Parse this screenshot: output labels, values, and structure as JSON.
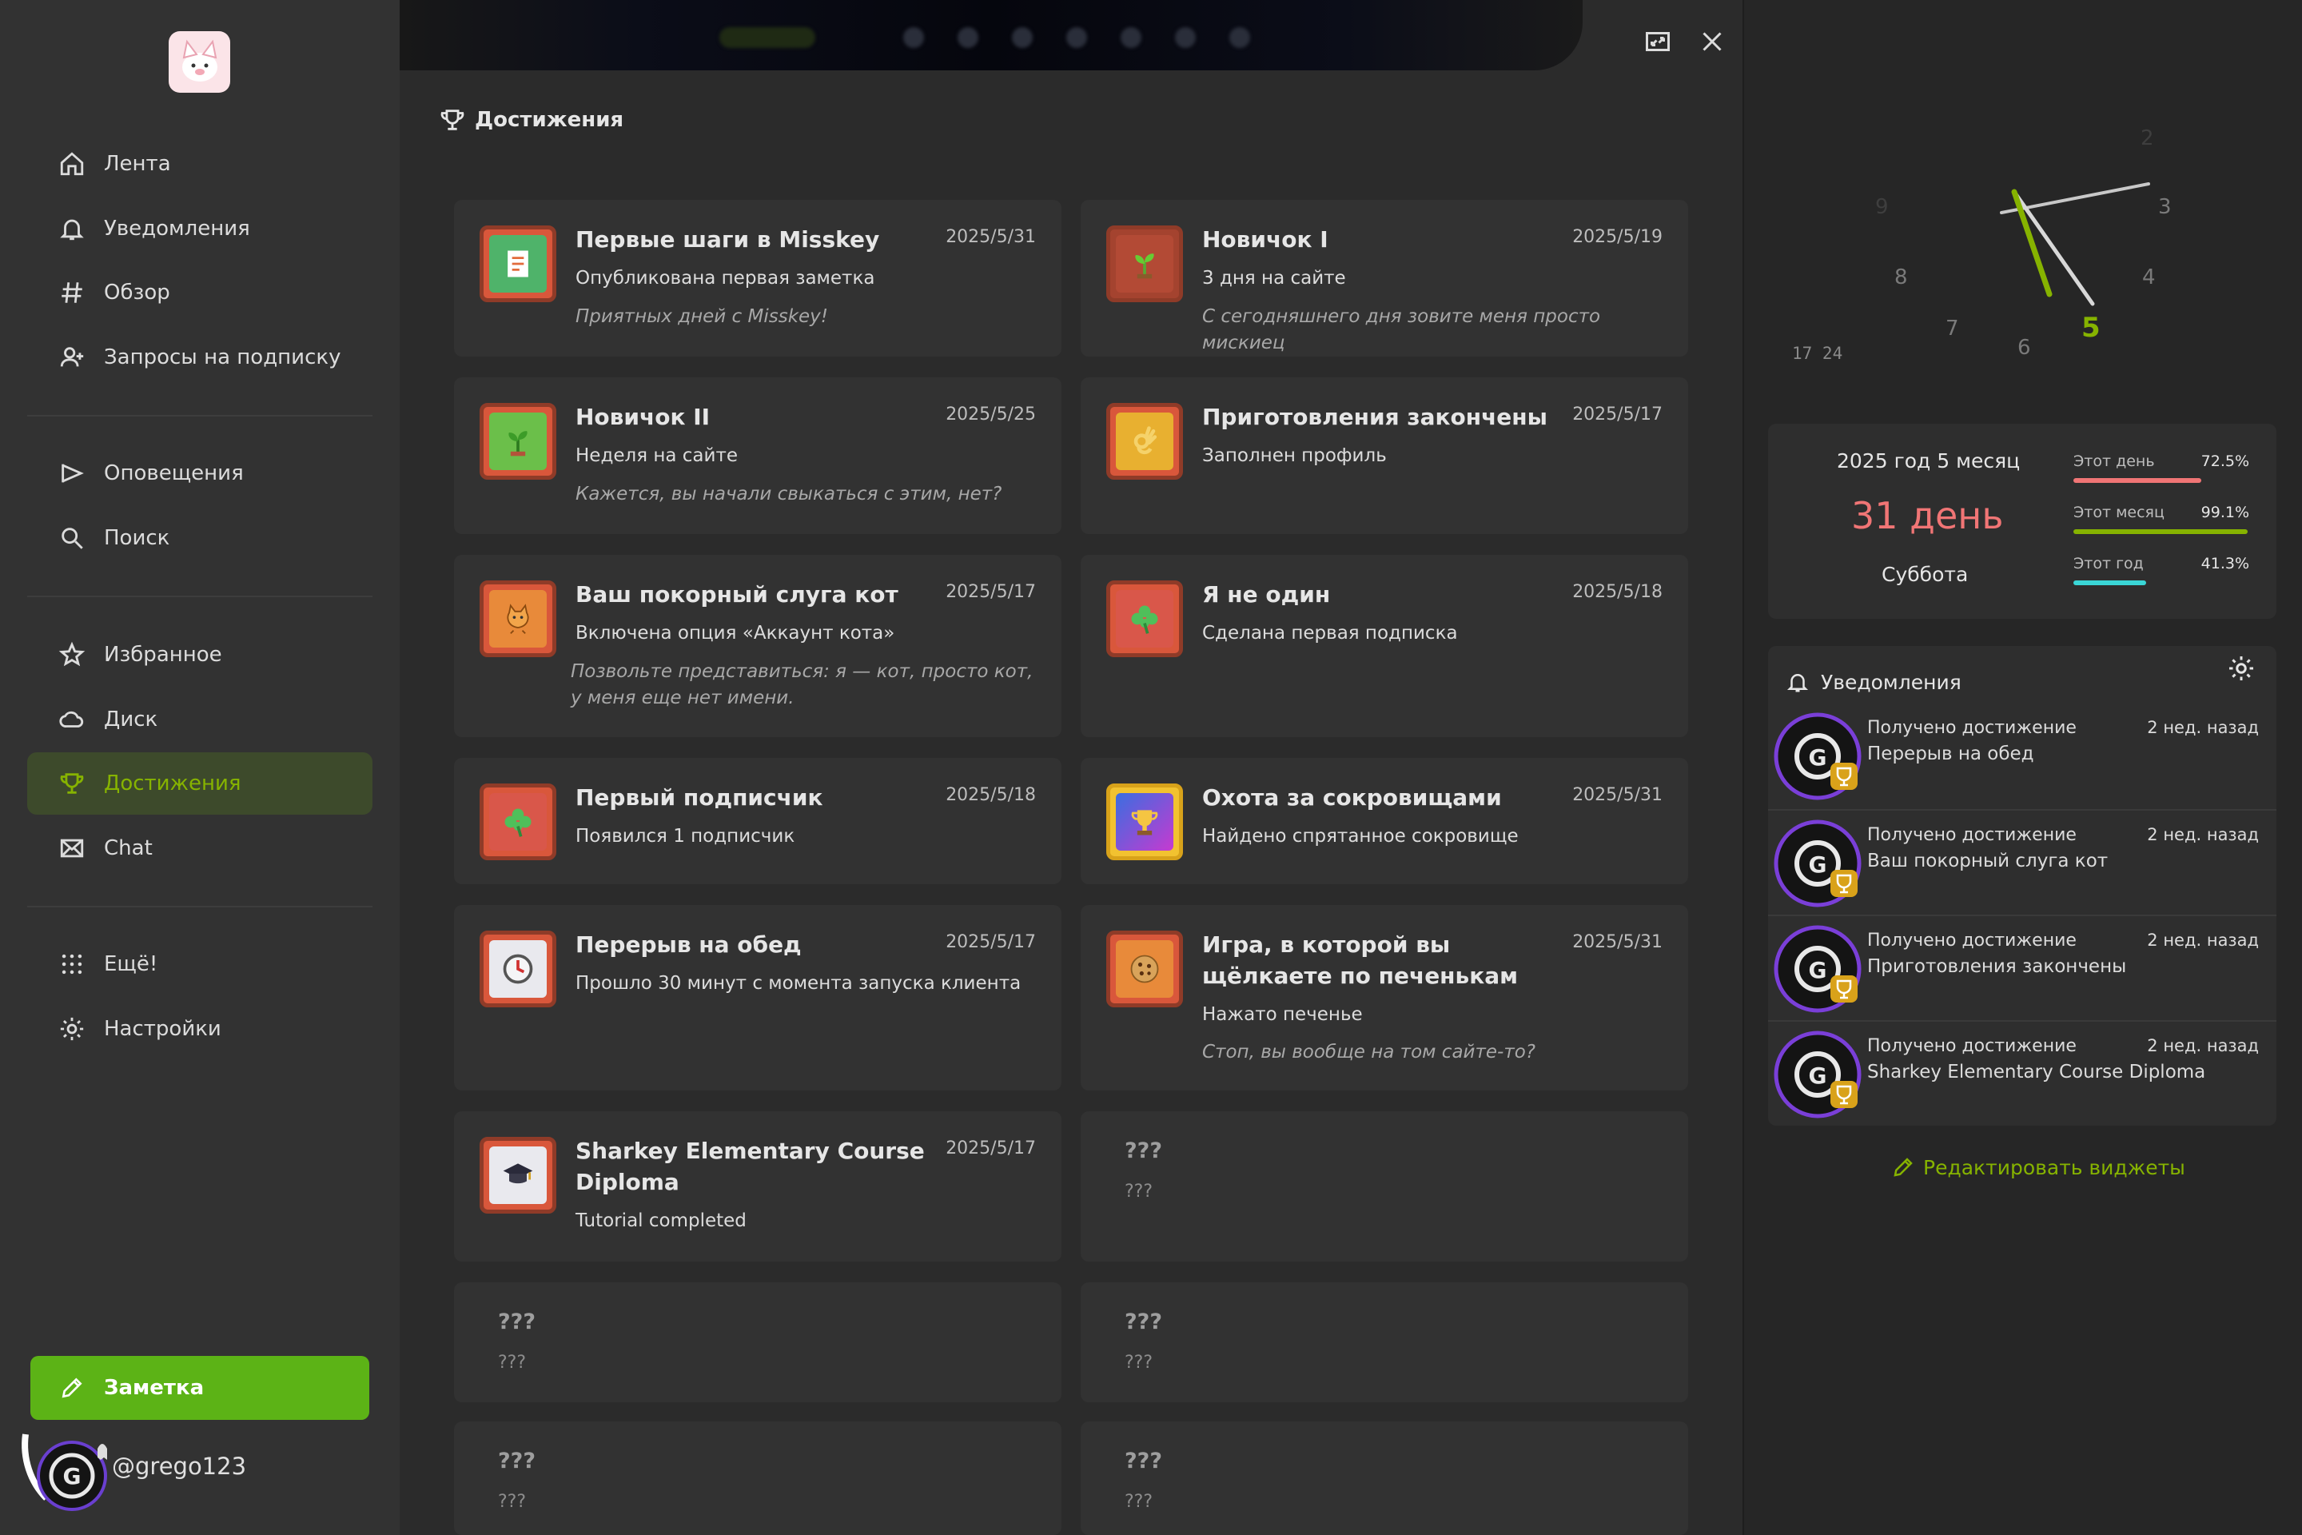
{
  "sidebar": {
    "items": [
      {
        "label": "Лента",
        "icon": "home-icon"
      },
      {
        "label": "Уведомления",
        "icon": "bell-icon"
      },
      {
        "label": "Обзор",
        "icon": "hash-icon"
      },
      {
        "label": "Запросы на подписку",
        "icon": "user-plus-icon"
      },
      {
        "label": "Оповещения",
        "icon": "announcement-icon"
      },
      {
        "label": "Поиск",
        "icon": "search-icon"
      },
      {
        "label": "Избранное",
        "icon": "star-icon"
      },
      {
        "label": "Диск",
        "icon": "cloud-icon"
      },
      {
        "label": "Достижения",
        "icon": "trophy-icon",
        "active": true
      },
      {
        "label": "Chat",
        "icon": "mail-icon"
      },
      {
        "label": "Ещё!",
        "icon": "dots-grid-icon"
      },
      {
        "label": "Настройки",
        "icon": "gear-icon"
      }
    ],
    "note_button": "Заметка",
    "account": "@grego123"
  },
  "page": {
    "title": "Достижения"
  },
  "achievements": [
    {
      "title": "Первые шаги в Misskey",
      "date": "2025/5/31",
      "desc": "Опубликована первая заметка",
      "flavor": "Приятных дней с Misskey!",
      "icon": "note-icon"
    },
    {
      "title": "Новичок I",
      "date": "2025/5/19",
      "desc": "3 дня на сайте",
      "flavor": "С сегодняшнего дня зовите меня просто мискиец",
      "icon": "sprout-icon"
    },
    {
      "title": "Новичок II",
      "date": "2025/5/25",
      "desc": "Неделя на сайте",
      "flavor": "Кажется, вы начали свыкаться с этим, нет?",
      "icon": "sprout-icon"
    },
    {
      "title": "Приготовления закончены",
      "date": "2025/5/17",
      "desc": "Заполнен профиль",
      "flavor": "",
      "icon": "ok-hand-icon"
    },
    {
      "title": "Ваш покорный слуга кот",
      "date": "2025/5/17",
      "desc": "Включена опция «Аккаунт кота»",
      "flavor": "Позвольте представиться: я — кот, просто кот, у меня еще нет имени.",
      "icon": "cat-icon"
    },
    {
      "title": "Я не один",
      "date": "2025/5/18",
      "desc": "Сделана первая подписка",
      "flavor": "",
      "icon": "clover-icon"
    },
    {
      "title": "Первый подписчик",
      "date": "2025/5/18",
      "desc": "Появился 1 подписчик",
      "flavor": "",
      "icon": "clover-icon"
    },
    {
      "title": "Охота за сокровищами",
      "date": "2025/5/31",
      "desc": "Найдено спрятанное сокровище",
      "flavor": "",
      "icon": "trophy-icon"
    },
    {
      "title": "Перерыв на обед",
      "date": "2025/5/17",
      "desc": "Прошло 30 минут с момента запуска клиента",
      "flavor": "",
      "icon": "clock-icon"
    },
    {
      "title": "Игра, в которой вы щёлкаете по печенькам",
      "date": "2025/5/31",
      "desc": "Нажато печенье",
      "flavor": "Стоп, вы вообще на том сайте-то?",
      "icon": "cookie-icon"
    },
    {
      "title": "Sharkey Elementary Course Diploma",
      "date": "2025/5/17",
      "desc": "Tutorial completed",
      "flavor": "",
      "icon": "graduation-cap-icon"
    },
    {
      "title": "???",
      "desc": "???"
    },
    {
      "title": "???",
      "desc": "???"
    },
    {
      "title": "???",
      "desc": "???"
    },
    {
      "title": "???",
      "desc": "???"
    },
    {
      "title": "???",
      "desc": "???"
    }
  ],
  "clock": {
    "numbers": [
      "2",
      "3",
      "4",
      "5",
      "6",
      "7",
      "8",
      "9"
    ],
    "time": "17 24"
  },
  "calendar": {
    "year_month": "2025 год  5 месяц",
    "day": "31 день",
    "weekday": "Суббота",
    "stats": [
      {
        "label": "Этот день",
        "value": "72.5%",
        "fraction": 0.725,
        "color": "#f07575"
      },
      {
        "label": "Этот месяц",
        "value": "99.1%",
        "fraction": 0.991,
        "color": "#86b300"
      },
      {
        "label": "Этот год",
        "value": "41.3%",
        "fraction": 0.413,
        "color": "#3ad6d6"
      }
    ]
  },
  "notifications": {
    "title": "Уведомления",
    "items": [
      {
        "line1": "Получено достижение",
        "line2": "Перерыв на обед",
        "time": "2 нед. назад"
      },
      {
        "line1": "Получено достижение",
        "line2": "Ваш покорный слуга кот",
        "time": "2 нед. назад"
      },
      {
        "line1": "Получено достижение",
        "line2": "Приготовления закончены",
        "time": "2 нед. назад"
      },
      {
        "line1": "Получено достижение",
        "line2": "Sharkey Elementary Course Diploma",
        "time": "2 нед. назад"
      }
    ]
  },
  "edit_widgets": "Редактировать виджеты",
  "colors": {
    "accent": "#86b300",
    "note_button": "#5cb316",
    "day_red": "#f07575"
  }
}
